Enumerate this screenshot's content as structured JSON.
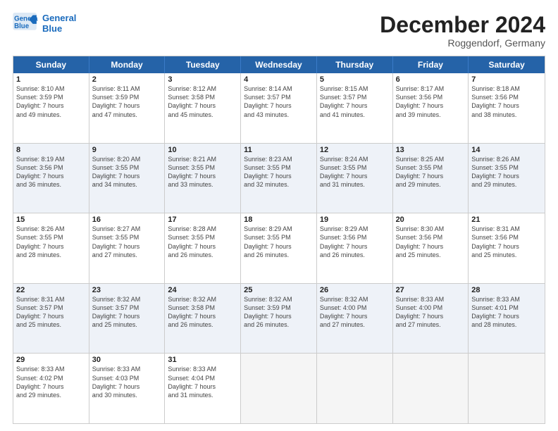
{
  "header": {
    "logo_line1": "General",
    "logo_line2": "Blue",
    "month": "December 2024",
    "location": "Roggendorf, Germany"
  },
  "weekdays": [
    "Sunday",
    "Monday",
    "Tuesday",
    "Wednesday",
    "Thursday",
    "Friday",
    "Saturday"
  ],
  "rows": [
    [
      {
        "day": "1",
        "lines": [
          "Sunrise: 8:10 AM",
          "Sunset: 3:59 PM",
          "Daylight: 7 hours",
          "and 49 minutes."
        ]
      },
      {
        "day": "2",
        "lines": [
          "Sunrise: 8:11 AM",
          "Sunset: 3:59 PM",
          "Daylight: 7 hours",
          "and 47 minutes."
        ]
      },
      {
        "day": "3",
        "lines": [
          "Sunrise: 8:12 AM",
          "Sunset: 3:58 PM",
          "Daylight: 7 hours",
          "and 45 minutes."
        ]
      },
      {
        "day": "4",
        "lines": [
          "Sunrise: 8:14 AM",
          "Sunset: 3:57 PM",
          "Daylight: 7 hours",
          "and 43 minutes."
        ]
      },
      {
        "day": "5",
        "lines": [
          "Sunrise: 8:15 AM",
          "Sunset: 3:57 PM",
          "Daylight: 7 hours",
          "and 41 minutes."
        ]
      },
      {
        "day": "6",
        "lines": [
          "Sunrise: 8:17 AM",
          "Sunset: 3:56 PM",
          "Daylight: 7 hours",
          "and 39 minutes."
        ]
      },
      {
        "day": "7",
        "lines": [
          "Sunrise: 8:18 AM",
          "Sunset: 3:56 PM",
          "Daylight: 7 hours",
          "and 38 minutes."
        ]
      }
    ],
    [
      {
        "day": "8",
        "lines": [
          "Sunrise: 8:19 AM",
          "Sunset: 3:56 PM",
          "Daylight: 7 hours",
          "and 36 minutes."
        ]
      },
      {
        "day": "9",
        "lines": [
          "Sunrise: 8:20 AM",
          "Sunset: 3:55 PM",
          "Daylight: 7 hours",
          "and 34 minutes."
        ]
      },
      {
        "day": "10",
        "lines": [
          "Sunrise: 8:21 AM",
          "Sunset: 3:55 PM",
          "Daylight: 7 hours",
          "and 33 minutes."
        ]
      },
      {
        "day": "11",
        "lines": [
          "Sunrise: 8:23 AM",
          "Sunset: 3:55 PM",
          "Daylight: 7 hours",
          "and 32 minutes."
        ]
      },
      {
        "day": "12",
        "lines": [
          "Sunrise: 8:24 AM",
          "Sunset: 3:55 PM",
          "Daylight: 7 hours",
          "and 31 minutes."
        ]
      },
      {
        "day": "13",
        "lines": [
          "Sunrise: 8:25 AM",
          "Sunset: 3:55 PM",
          "Daylight: 7 hours",
          "and 29 minutes."
        ]
      },
      {
        "day": "14",
        "lines": [
          "Sunrise: 8:26 AM",
          "Sunset: 3:55 PM",
          "Daylight: 7 hours",
          "and 29 minutes."
        ]
      }
    ],
    [
      {
        "day": "15",
        "lines": [
          "Sunrise: 8:26 AM",
          "Sunset: 3:55 PM",
          "Daylight: 7 hours",
          "and 28 minutes."
        ]
      },
      {
        "day": "16",
        "lines": [
          "Sunrise: 8:27 AM",
          "Sunset: 3:55 PM",
          "Daylight: 7 hours",
          "and 27 minutes."
        ]
      },
      {
        "day": "17",
        "lines": [
          "Sunrise: 8:28 AM",
          "Sunset: 3:55 PM",
          "Daylight: 7 hours",
          "and 26 minutes."
        ]
      },
      {
        "day": "18",
        "lines": [
          "Sunrise: 8:29 AM",
          "Sunset: 3:55 PM",
          "Daylight: 7 hours",
          "and 26 minutes."
        ]
      },
      {
        "day": "19",
        "lines": [
          "Sunrise: 8:29 AM",
          "Sunset: 3:56 PM",
          "Daylight: 7 hours",
          "and 26 minutes."
        ]
      },
      {
        "day": "20",
        "lines": [
          "Sunrise: 8:30 AM",
          "Sunset: 3:56 PM",
          "Daylight: 7 hours",
          "and 25 minutes."
        ]
      },
      {
        "day": "21",
        "lines": [
          "Sunrise: 8:31 AM",
          "Sunset: 3:56 PM",
          "Daylight: 7 hours",
          "and 25 minutes."
        ]
      }
    ],
    [
      {
        "day": "22",
        "lines": [
          "Sunrise: 8:31 AM",
          "Sunset: 3:57 PM",
          "Daylight: 7 hours",
          "and 25 minutes."
        ]
      },
      {
        "day": "23",
        "lines": [
          "Sunrise: 8:32 AM",
          "Sunset: 3:57 PM",
          "Daylight: 7 hours",
          "and 25 minutes."
        ]
      },
      {
        "day": "24",
        "lines": [
          "Sunrise: 8:32 AM",
          "Sunset: 3:58 PM",
          "Daylight: 7 hours",
          "and 26 minutes."
        ]
      },
      {
        "day": "25",
        "lines": [
          "Sunrise: 8:32 AM",
          "Sunset: 3:59 PM",
          "Daylight: 7 hours",
          "and 26 minutes."
        ]
      },
      {
        "day": "26",
        "lines": [
          "Sunrise: 8:32 AM",
          "Sunset: 4:00 PM",
          "Daylight: 7 hours",
          "and 27 minutes."
        ]
      },
      {
        "day": "27",
        "lines": [
          "Sunrise: 8:33 AM",
          "Sunset: 4:00 PM",
          "Daylight: 7 hours",
          "and 27 minutes."
        ]
      },
      {
        "day": "28",
        "lines": [
          "Sunrise: 8:33 AM",
          "Sunset: 4:01 PM",
          "Daylight: 7 hours",
          "and 28 minutes."
        ]
      }
    ],
    [
      {
        "day": "29",
        "lines": [
          "Sunrise: 8:33 AM",
          "Sunset: 4:02 PM",
          "Daylight: 7 hours",
          "and 29 minutes."
        ]
      },
      {
        "day": "30",
        "lines": [
          "Sunrise: 8:33 AM",
          "Sunset: 4:03 PM",
          "Daylight: 7 hours",
          "and 30 minutes."
        ]
      },
      {
        "day": "31",
        "lines": [
          "Sunrise: 8:33 AM",
          "Sunset: 4:04 PM",
          "Daylight: 7 hours",
          "and 31 minutes."
        ]
      },
      {
        "day": "",
        "lines": []
      },
      {
        "day": "",
        "lines": []
      },
      {
        "day": "",
        "lines": []
      },
      {
        "day": "",
        "lines": []
      }
    ]
  ]
}
